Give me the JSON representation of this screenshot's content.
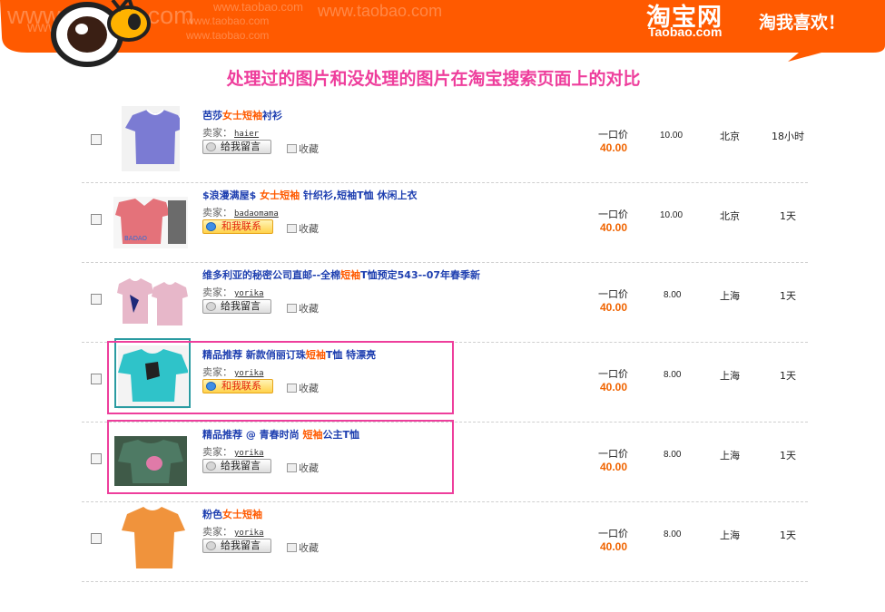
{
  "header": {
    "brand_cn": "淘宝网",
    "brand_en": "Taobao.com",
    "slogan": "淘我喜欢！",
    "watermark_large": "www.taobao.com",
    "watermark_small": "www.taobao.com",
    "bg_color": "#ff5a00"
  },
  "page_title": "处理过的图片和没处理的图片在淘宝搜索页面上的对比",
  "labels": {
    "seller_prefix": "卖家：",
    "leave_message": "给我留言",
    "contact_me": "和我联系",
    "favorite": "收藏",
    "price_label": "一口价"
  },
  "items": [
    {
      "title_parts": [
        {
          "t": "芭莎",
          "hl": false
        },
        {
          "t": "女士短袖",
          "hl": true
        },
        {
          "t": "衬衫",
          "hl": false
        }
      ],
      "seller": "haier",
      "action": "给我留言",
      "price": "40.00",
      "shipping": "10.00",
      "location": "北京",
      "time_left": "18小时",
      "shirt_color": "#7b7bd3"
    },
    {
      "title_parts": [
        {
          "t": "$浪漫满屋$ ",
          "hl": false
        },
        {
          "t": "女士短袖",
          "hl": true
        },
        {
          "t": " 针织衫,短袖T恤 休闲上衣",
          "hl": false
        }
      ],
      "seller": "badaomama",
      "action": "和我联系",
      "price": "40.00",
      "shipping": "10.00",
      "location": "北京",
      "time_left": "1天",
      "shirt_color": "#e4727a"
    },
    {
      "title_parts": [
        {
          "t": "维多利亚的秘密公司直邮--全棉",
          "hl": false
        },
        {
          "t": "短袖",
          "hl": true
        },
        {
          "t": "T恤预定543--07年春季新",
          "hl": false
        }
      ],
      "seller": "yorika",
      "action": "给我留言",
      "price": "40.00",
      "shipping": "8.00",
      "location": "上海",
      "time_left": "1天",
      "shirt_color": "#e7b7c9"
    },
    {
      "title_parts": [
        {
          "t": "精品推荐 新款俏丽订珠",
          "hl": false
        },
        {
          "t": "短袖",
          "hl": true
        },
        {
          "t": "T恤 特漂亮",
          "hl": false
        }
      ],
      "seller": "yorika",
      "action": "和我联系",
      "price": "40.00",
      "shipping": "8.00",
      "location": "上海",
      "time_left": "1天",
      "shirt_color": "#2fc3c9"
    },
    {
      "title_parts": [
        {
          "t": "精品推荐 @ 青春时尚 ",
          "hl": false
        },
        {
          "t": "短袖",
          "hl": true
        },
        {
          "t": "公主T恤",
          "hl": false
        }
      ],
      "seller": "yorika",
      "action": "给我留言",
      "price": "40.00",
      "shipping": "8.00",
      "location": "上海",
      "time_left": "1天",
      "shirt_color": "#3f5a48"
    },
    {
      "title_parts": [
        {
          "t": "粉色",
          "hl": false
        },
        {
          "t": "女士短袖",
          "hl": true
        }
      ],
      "seller": "yorika",
      "action": "给我留言",
      "price": "40.00",
      "shipping": "8.00",
      "location": "上海",
      "time_left": "1天",
      "shirt_color": "#f0933c"
    }
  ],
  "colors": {
    "accent": "#ee3e9c",
    "link": "#1e3fb0",
    "highlight": "#ff5a00",
    "price": "#f06400"
  }
}
